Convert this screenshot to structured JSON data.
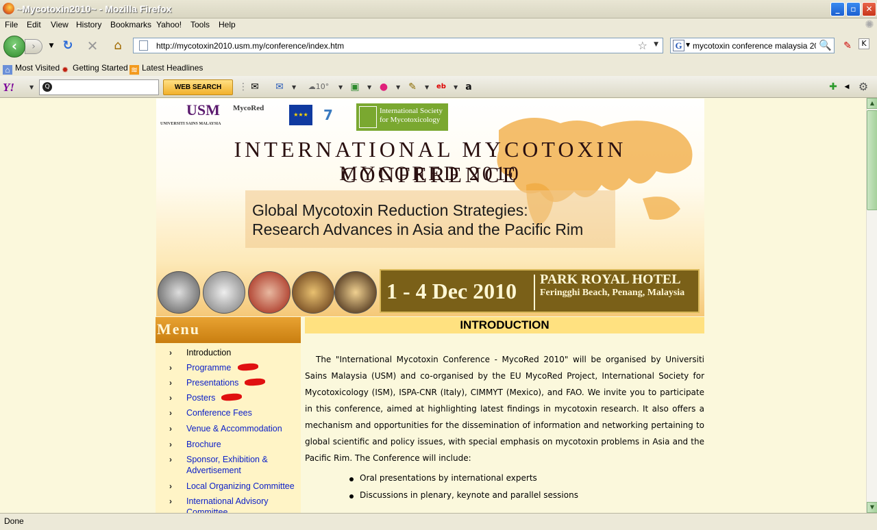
{
  "window": {
    "title": "~Mycotoxin2010~ - Mozilla Firefox",
    "min": "_",
    "max": "▫",
    "close": "✕"
  },
  "menubar": [
    "File",
    "Edit",
    "View",
    "History",
    "Bookmarks",
    "Yahoo!",
    "Tools",
    "Help"
  ],
  "navbar": {
    "url": "http://mycotoxin2010.usm.my/conference/index.htm",
    "search_value": "mycotoxin conference malaysia 2010",
    "search_engine": "G"
  },
  "bookmarks": [
    "Most Visited",
    "Getting Started",
    "Latest Headlines"
  ],
  "yahoo_toolbar": {
    "logo": "Y!",
    "web_search_label": "WEB SEARCH",
    "weather": "10°"
  },
  "banner": {
    "usm_logo": "USM",
    "usm_caption": "UNIVERSITI SAINS MALAYSIA",
    "mycored_logo": "MycoRed",
    "ism_logo": "International Society for Mycotoxicology",
    "title_line1": "INTERNATIONAL MYCOTOXIN CONFERENCE",
    "title_line2": "MYCORED 2010",
    "subtitle_line1": "Global Mycotoxin Reduction Strategies:",
    "subtitle_line2": "Research Advances in Asia and the Pacific Rim",
    "date": "1 - 4 Dec 2010",
    "venue": "PARK ROYAL HOTEL",
    "location": "Feringghi Beach, Penang, Malaysia"
  },
  "menu": {
    "heading": "Menu",
    "items": [
      {
        "label": "Introduction",
        "new": false
      },
      {
        "label": "Programme",
        "new": true
      },
      {
        "label": "Presentations",
        "new": true
      },
      {
        "label": "Posters",
        "new": true
      },
      {
        "label": "Conference Fees",
        "new": false
      },
      {
        "label": "Venue & Accommodation",
        "new": false
      },
      {
        "label": "Brochure",
        "new": false
      },
      {
        "label": "Sponsor, Exhibition &",
        "label2": "Advertisement",
        "new": false
      },
      {
        "label": "Local Organizing Committee",
        "new": false
      },
      {
        "label": "International Advisory",
        "label2": "Committee",
        "new": false
      }
    ]
  },
  "intro": {
    "heading": "INTRODUCTION",
    "paragraph": "The \"International Mycotoxin Conference - MycoRed 2010\" will be organised by Universiti Sains Malaysia (USM) and co-organised by the EU MycoRed Project, International Society for Mycotoxicology (ISM), ISPA-CNR (Italy), CIMMYT (Mexico), and FAO. We invite you to participate in this conference, aimed at highlighting latest findings in mycotoxin research.  It also offers a mechanism and opportunities for the dissemination of information and networking pertaining to global scientific and policy issues, with special emphasis on mycotoxin problems in Asia and the Pacific Rim. The Conference will include:",
    "bullets": [
      "Oral presentations by international experts",
      "Discussions in plenary, keynote and parallel sessions"
    ]
  },
  "status": "Done"
}
